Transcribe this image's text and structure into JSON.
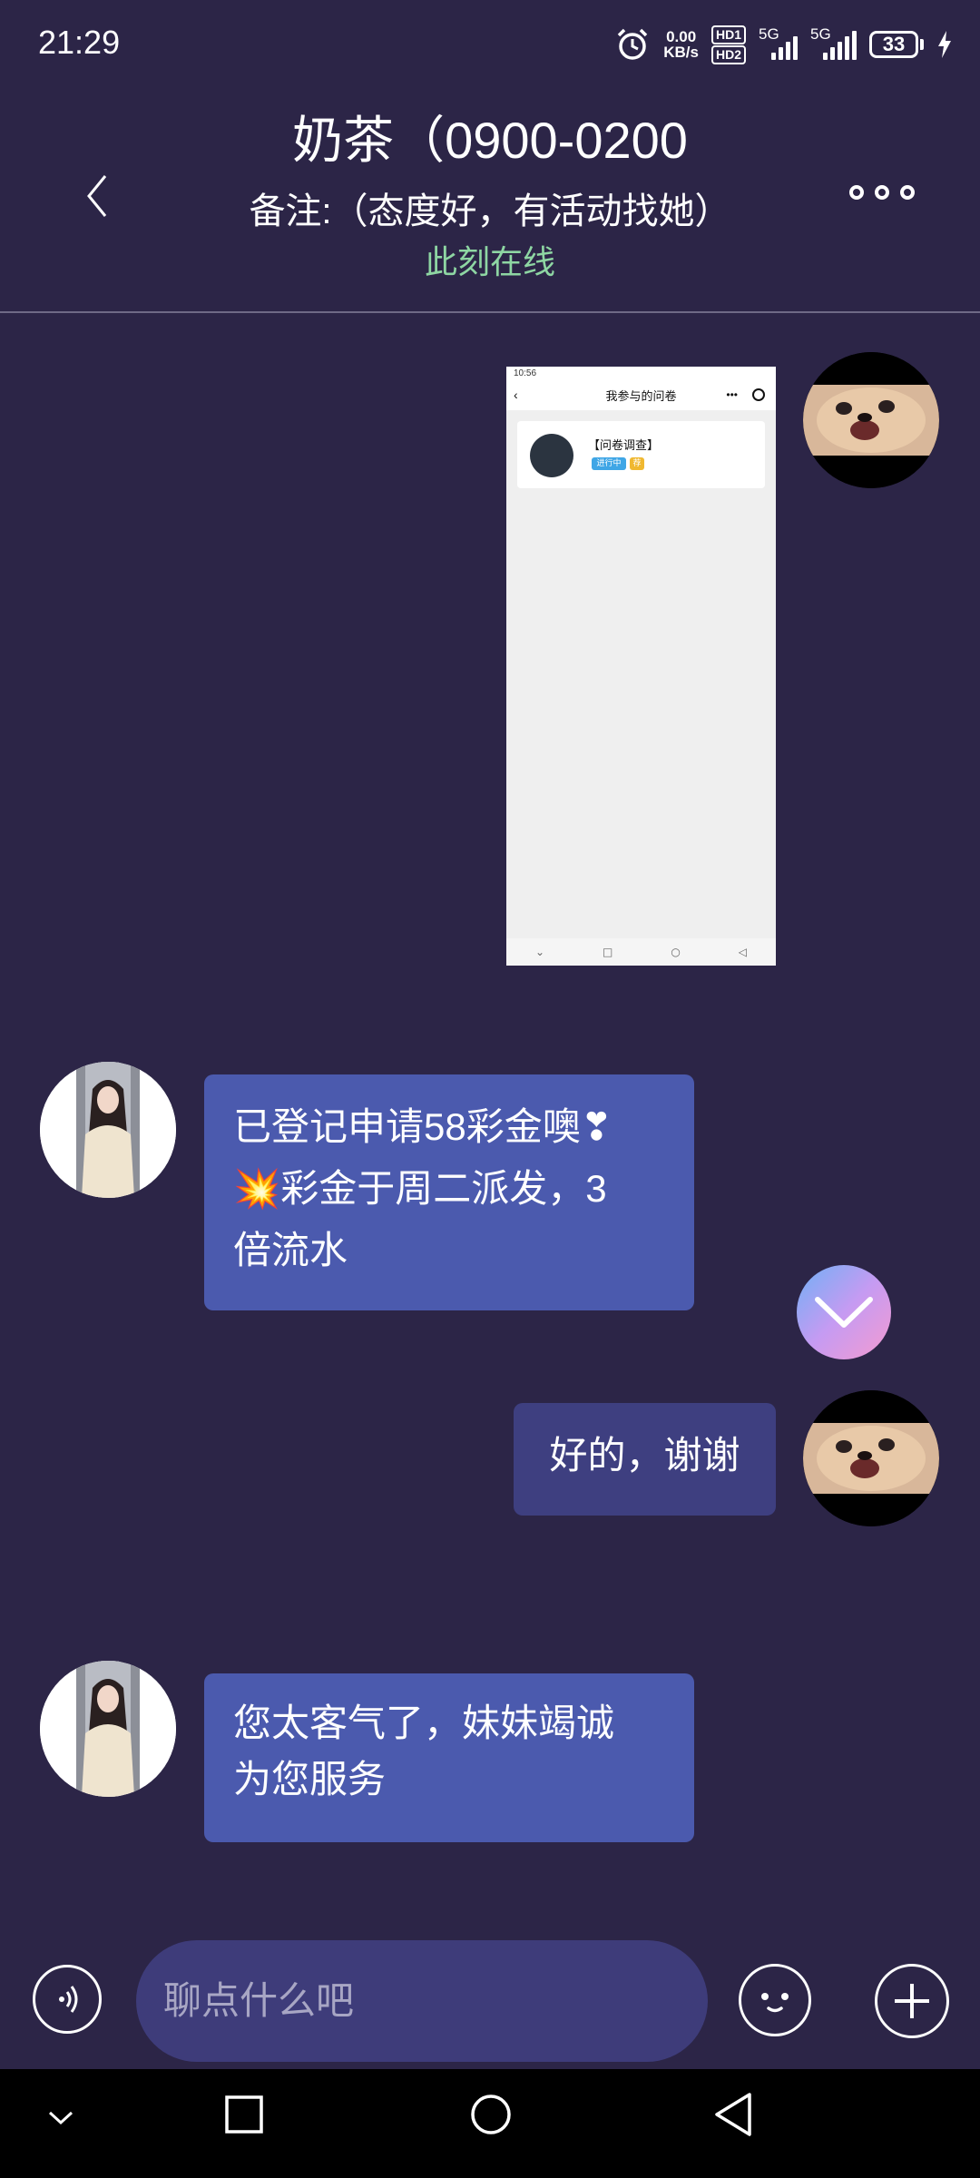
{
  "status_bar": {
    "time": "21:29",
    "net_speed_value": "0.00",
    "net_speed_unit": "KB/s",
    "hd1": "HD1",
    "hd2": "HD2",
    "signal1_label": "5G",
    "signal2_label": "5G",
    "battery_level": "33"
  },
  "header": {
    "contact_name": "奶茶（0900-0200",
    "note": "备注:（态度好，有活动找她）",
    "online_status": "此刻在线"
  },
  "messages": [
    {
      "direction": "outgoing",
      "type": "image",
      "image": {
        "status_time": "10:56",
        "nav_title": "我参与的问卷",
        "card_title": "【问卷调查】",
        "tag_status": "进行中",
        "tag_extra": "荐"
      }
    },
    {
      "direction": "incoming",
      "type": "text",
      "line1": "已登记申请58彩金噢❣",
      "line2": "💥彩金于周二派发，3",
      "line3": "倍流水"
    },
    {
      "direction": "outgoing",
      "type": "text",
      "text": "好的，谢谢"
    },
    {
      "direction": "incoming",
      "type": "text",
      "line1": "您太客气了，妹妹竭诚",
      "line2": "为您服务"
    }
  ],
  "input": {
    "placeholder": "聊点什么吧"
  },
  "colors": {
    "background": "#2c2547",
    "incoming_bubble": "#4b5aae",
    "outgoing_bubble": "#3e3f80",
    "online": "#8ed6a3",
    "input_bg": "#3e3c7a"
  },
  "icons": [
    "back-chevron-icon",
    "more-dots-icon",
    "voice-icon",
    "emoji-icon",
    "plus-icon",
    "scroll-down-chevron-icon",
    "alarm-icon",
    "charging-bolt-icon",
    "nav-down-icon",
    "nav-square-icon",
    "nav-circle-icon",
    "nav-back-icon"
  ]
}
